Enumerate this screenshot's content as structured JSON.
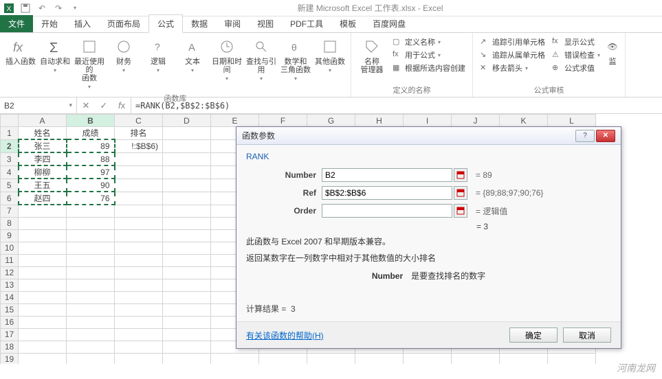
{
  "app": {
    "title": "新建 Microsoft Excel 工作表.xlsx - Excel"
  },
  "tabs": {
    "file": "文件",
    "items": [
      "开始",
      "插入",
      "页面布局",
      "公式",
      "数据",
      "审阅",
      "视图",
      "PDF工具",
      "模板",
      "百度网盘"
    ],
    "active_index": 3
  },
  "ribbon": {
    "group_funclib": "函数库",
    "group_names": "定义的名称",
    "group_audit": "公式审核",
    "insert_fn": "插入函数",
    "autosum": "自动求和",
    "recent": "最近使用的\n函数",
    "financial": "财务",
    "logical": "逻辑",
    "text": "文本",
    "datetime": "日期和时间",
    "lookup": "查找与引用",
    "math": "数学和\n三角函数",
    "more": "其他函数",
    "name_mgr": "名称\n管理器",
    "define_name": "定义名称",
    "use_in_formula": "用于公式",
    "create_from_sel": "根据所选内容创建",
    "trace_prec": "追踪引用单元格",
    "trace_dep": "追踪从属单元格",
    "remove_arrows": "移去箭头",
    "show_formulas": "显示公式",
    "error_check": "错误检查",
    "eval_formula": "公式求值",
    "watch": "监"
  },
  "formula_bar": {
    "namebox": "B2",
    "formula": "=RANK(B2,$B$2:$B$6)"
  },
  "sheet": {
    "cols": [
      "A",
      "B",
      "C",
      "D",
      "E",
      "F",
      "G",
      "H",
      "I",
      "J",
      "K",
      "L"
    ],
    "headers": {
      "a": "姓名",
      "b": "成绩",
      "c": "排名"
    },
    "rows": [
      {
        "name": "张三",
        "score": "89",
        "c": "!:$B$6)"
      },
      {
        "name": "李四",
        "score": "88"
      },
      {
        "name": "柳柳",
        "score": "97"
      },
      {
        "name": "王五",
        "score": "90"
      },
      {
        "name": "赵四",
        "score": "76"
      }
    ]
  },
  "dialog": {
    "title": "函数参数",
    "fn": "RANK",
    "args": {
      "number": {
        "label": "Number",
        "value": "B2",
        "result": "= 89"
      },
      "ref": {
        "label": "Ref",
        "value": "$B$2:$B$6",
        "result": "= {89;88;97;90;76}"
      },
      "order": {
        "label": "Order",
        "value": "",
        "result": "= 逻辑值"
      }
    },
    "preview": "= 3",
    "desc1": "此函数与 Excel 2007 和早期版本兼容。",
    "desc2": "返回某数字在一列数字中相对于其他数值的大小排名",
    "arg_name": "Number",
    "arg_desc": "是要查找排名的数字",
    "calc_result_label": "计算结果 =",
    "calc_result": "3",
    "help": "有关该函数的帮助(H)",
    "ok": "确定",
    "cancel": "取消"
  },
  "watermark": "河南龙网"
}
